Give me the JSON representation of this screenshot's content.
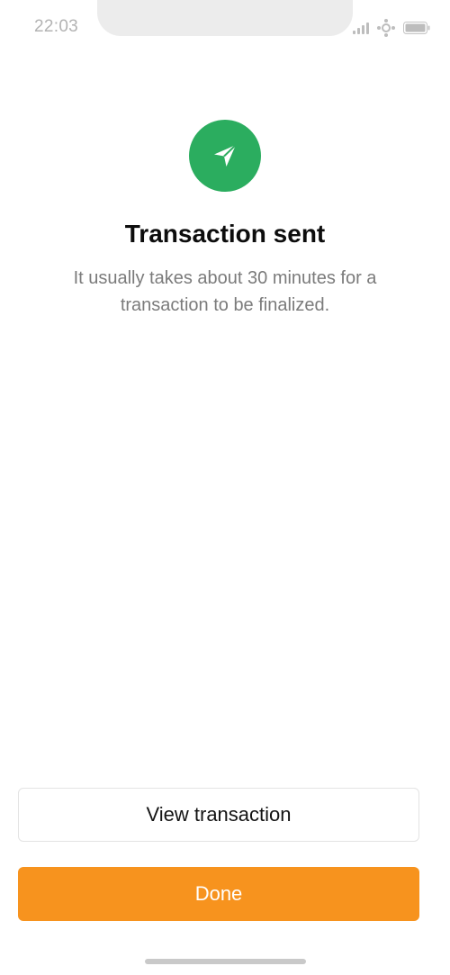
{
  "status_bar": {
    "time": "22:03",
    "icons": [
      "signal-icon",
      "wifi-icon",
      "battery-icon"
    ]
  },
  "screen": {
    "icon": "send-arrow-icon",
    "accent_color": "#2bad5f",
    "title": "Transaction sent",
    "subtitle": "It usually takes about 30 minutes for a transaction to be finalized."
  },
  "actions": {
    "view_transaction_label": "View transaction",
    "done_label": "Done",
    "done_color": "#f7931e"
  }
}
